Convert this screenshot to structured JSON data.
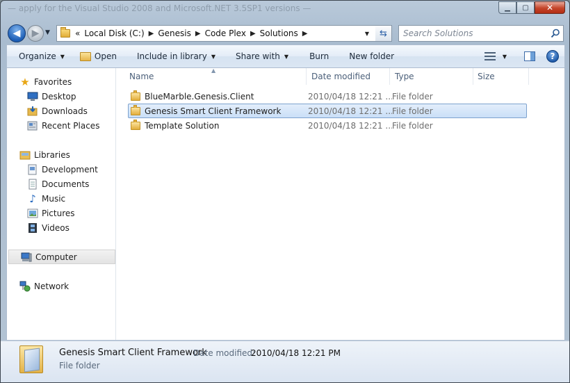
{
  "window": {
    "title": "Genesis Smart Client Framework",
    "ghost_title": "— apply for the Visual Studio 2008 and Microsoft.NET 3.5SP1 versions —"
  },
  "address": {
    "overflow": "«",
    "crumbs": [
      "Local Disk (C:)",
      "Genesis",
      "Code Plex",
      "Solutions"
    ]
  },
  "search": {
    "placeholder": "Search Solutions"
  },
  "toolbar": {
    "organize": "Organize",
    "open": "Open",
    "include": "Include in library",
    "share": "Share with",
    "burn": "Burn",
    "new_folder": "New folder"
  },
  "nav": {
    "favorites": "Favorites",
    "desktop": "Desktop",
    "downloads": "Downloads",
    "recent": "Recent Places",
    "libraries": "Libraries",
    "development": "Development",
    "documents": "Documents",
    "music": "Music",
    "pictures": "Pictures",
    "videos": "Videos",
    "computer": "Computer",
    "network": "Network"
  },
  "columns": {
    "name": "Name",
    "date": "Date modified",
    "type": "Type",
    "size": "Size"
  },
  "files": [
    {
      "name": "BlueMarble.Genesis.Client",
      "date": "2010/04/18 12:21 ...",
      "type": "File folder",
      "size": ""
    },
    {
      "name": "Genesis Smart Client Framework",
      "date": "2010/04/18 12:21 ...",
      "type": "File folder",
      "size": ""
    },
    {
      "name": "Template Solution",
      "date": "2010/04/18 12:21 ...",
      "type": "File folder",
      "size": ""
    }
  ],
  "details": {
    "name": "Genesis Smart Client Framework",
    "date_label": "Date modified:",
    "date_value": "2010/04/18 12:21 PM",
    "type": "File folder"
  },
  "colors": {
    "selection": "#cadff7",
    "selection_border": "#7da2ce",
    "header_text": "#4c607a"
  }
}
